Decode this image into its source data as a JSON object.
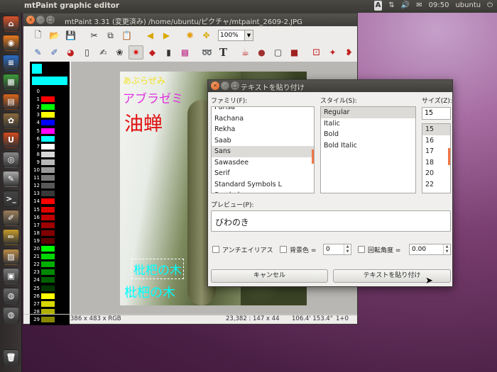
{
  "topbar": {
    "app_name": "mtPaint graphic editor",
    "time": "09:50",
    "user": "ubuntu",
    "kbd": "A",
    "mail": "✉",
    "sound": "🔊",
    "net": "⇅"
  },
  "launcher": {
    "items": [
      {
        "name": "home",
        "color": "#d9532b",
        "glyph": "⌂"
      },
      {
        "name": "firefox",
        "color": "#e87a1f",
        "glyph": "◉"
      },
      {
        "name": "writer",
        "color": "#2b6cc3",
        "glyph": "≡"
      },
      {
        "name": "calc",
        "color": "#3c9b3a",
        "glyph": "▦"
      },
      {
        "name": "impress",
        "color": "#d5641d",
        "glyph": "▤"
      },
      {
        "name": "mahjong",
        "color": "#8b6b3e",
        "glyph": "✿"
      },
      {
        "name": "software-center",
        "color": "#d24a1f",
        "glyph": "U"
      },
      {
        "name": "camera",
        "color": "#888",
        "glyph": "◎"
      },
      {
        "name": "text-editor",
        "color": "#aaa",
        "glyph": "✎"
      },
      {
        "name": "terminal",
        "color": "#444",
        "glyph": ">_"
      },
      {
        "name": "gimp",
        "color": "#9b7e5a",
        "glyph": "✐"
      },
      {
        "name": "pencils",
        "color": "#c79a2b",
        "glyph": "✏"
      },
      {
        "name": "mtpaint",
        "color": "#b98b4a",
        "glyph": "▨"
      },
      {
        "name": "monitor",
        "color": "#777",
        "glyph": "▣"
      },
      {
        "name": "disk1",
        "color": "#666",
        "glyph": "◍"
      },
      {
        "name": "disk2",
        "color": "#666",
        "glyph": "◍"
      },
      {
        "name": "trash",
        "color": "#555",
        "glyph": "🗑"
      }
    ]
  },
  "mtpaint": {
    "title": "mtPaint 3.31 (変更済み) /home/ubuntu/ピクチャ/mtpaint_2609-2.JPG",
    "zoom": "100%",
    "toolbar1": [
      "new",
      "open",
      "save",
      "cut",
      "copy",
      "paste",
      "undo",
      "redo",
      "pan",
      "move",
      "zoom"
    ],
    "toolbar2": [
      "pencil",
      "brush",
      "fill",
      "line",
      "smudge",
      "clone",
      "select-active",
      "polygon",
      "lasso",
      "gradient",
      "spray",
      "text",
      "cup",
      "blob",
      "rect",
      "rect-fill",
      "select",
      "shape",
      "lasso-red"
    ],
    "palette_colors": [
      "#000000",
      "#ff0000",
      "#00ff00",
      "#ffff00",
      "#0000ff",
      "#ff00ff",
      "#00ffff",
      "#ffffff",
      "#d8d8d8",
      "#b8b8b8",
      "#989898",
      "#787878",
      "#585858",
      "#383838",
      "#ff0000",
      "#e00000",
      "#c00000",
      "#a00000",
      "#800000",
      "#600000",
      "#00ff00",
      "#00d800",
      "#00b000",
      "#008800",
      "#006000",
      "#003800",
      "#ffff00",
      "#d8d800",
      "#b0b000",
      "#888800"
    ],
    "palette_numbers": [
      "0",
      "1",
      "2",
      "3",
      "4",
      "5",
      "6",
      "7",
      "8",
      "9",
      "10",
      "11",
      "12",
      "13",
      "14",
      "15",
      "16",
      "17",
      "18",
      "19",
      "20",
      "21",
      "22",
      "23",
      "24",
      "25",
      "26",
      "27",
      "28",
      "29"
    ],
    "image_texts": {
      "hiragana": "あぶらぜみ",
      "katakana": "アブラゼミ",
      "kanji": "油蝉",
      "box_text": "枇杷の木",
      "bottom_text": "枇杷の木"
    },
    "status": {
      "size": "386 x 483 x RGB",
      "coords": "23,382 : 147 x 44",
      "angle": "106.4' 153.4\"",
      "frame": "1+0"
    }
  },
  "dialog": {
    "title": "テキストを貼り付け",
    "family_label": "ファミリ(F):",
    "style_label": "スタイル(S):",
    "size_label": "サイズ(Z):",
    "families": [
      "Purisa",
      "Rachana",
      "Rekha",
      "Saab",
      "Sans",
      "Sawasdee",
      "Serif",
      "Standard Symbols L",
      "Symbol"
    ],
    "selected_family": "Sans",
    "styles": [
      "Regular",
      "Italic",
      "Bold",
      "Bold Italic"
    ],
    "selected_style": "Regular",
    "size_value": "15",
    "sizes": [
      "15",
      "16",
      "17",
      "18",
      "20",
      "22"
    ],
    "preview_label": "プレビュー(P):",
    "preview_text": "びわのき",
    "antialias_label": "アンチエイリアス",
    "bgcolor_label": "背景色 =",
    "bgcolor_value": "0",
    "rotate_label": "回転角度 =",
    "rotate_value": "0.00",
    "cancel_label": "キャンセル",
    "paste_label": "テキストを貼り付け"
  }
}
